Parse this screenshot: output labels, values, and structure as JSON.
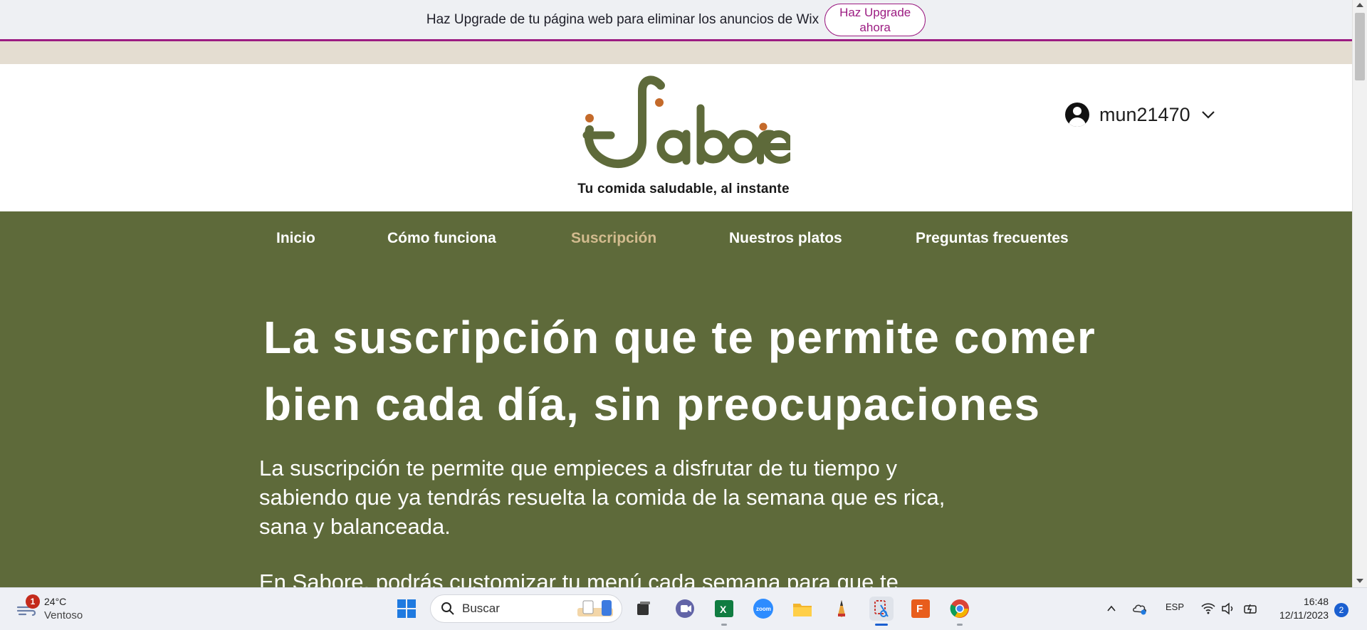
{
  "banner": {
    "text": "Haz Upgrade de tu página web para eliminar los anuncios de Wix",
    "button_line1": "Haz Upgrade",
    "button_line2": "ahora"
  },
  "header": {
    "tagline": "Tu comida saludable, al instante",
    "username": "mun21470"
  },
  "nav": {
    "items": [
      {
        "label": "Inicio"
      },
      {
        "label": "Cómo funciona"
      },
      {
        "label": "Suscripción"
      },
      {
        "label": "Nuestros platos"
      },
      {
        "label": "Preguntas frecuentes"
      }
    ],
    "active": "Suscripción"
  },
  "hero": {
    "title_line1": "La suscripción que te permite comer",
    "title_line2": "bien cada día, sin preocupaciones",
    "paragraph_line1": "La suscripción te permite que empieces a disfrutar de tu tiempo y",
    "paragraph_line2": "sabiendo que ya tendrás resuelta la comida de la semana que es rica,",
    "paragraph_line3": "sana y balanceada.",
    "paragraph2_partial": "En Sabore, podrás customizar tu menú cada semana para que te"
  },
  "colors": {
    "brand_green": "#5e6a3a",
    "logo_orange": "#c46a2a",
    "active_nav": "#d2bb8e",
    "wix_purple": "#9c1c82"
  },
  "taskbar": {
    "weather_temp": "24°C",
    "weather_cond": "Ventoso",
    "weather_badge": "1",
    "search_placeholder": "Buscar",
    "language": "ESP",
    "time": "16:48",
    "date": "12/11/2023",
    "notifications": "2",
    "icons": [
      "windows-start-icon",
      "search-icon",
      "task-view-icon",
      "teams-icon",
      "excel-icon",
      "zoom-icon",
      "file-explorer-icon",
      "pencil-app-icon",
      "snipping-tool-icon",
      "fusion-360-icon",
      "chrome-icon"
    ]
  }
}
